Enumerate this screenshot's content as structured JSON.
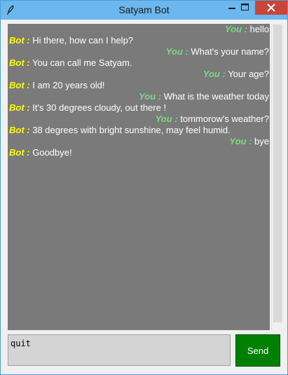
{
  "window": {
    "title": "Satyam Bot",
    "icon": "feather-icon",
    "controls": [
      "minimize-icon",
      "maximize-icon",
      "close-icon"
    ]
  },
  "chat": {
    "messages": [
      {
        "speaker": "You :",
        "text": " hello",
        "side": "you"
      },
      {
        "speaker": "Bot :",
        "text": " Hi there, how can I help?",
        "side": "bot"
      },
      {
        "speaker": "You :",
        "text": " What's your name?",
        "side": "you"
      },
      {
        "speaker": "Bot :",
        "text": " You can call me Satyam.",
        "side": "bot"
      },
      {
        "speaker": "You :",
        "text": " Your age?",
        "side": "you"
      },
      {
        "speaker": "Bot :",
        "text": " I am 20 years old!",
        "side": "bot"
      },
      {
        "speaker": "You :",
        "text": " What is the weather today",
        "side": "you"
      },
      {
        "speaker": "Bot :",
        "text": " It's 30 degrees cloudy, out there !",
        "side": "bot"
      },
      {
        "speaker": "You :",
        "text": " tommorow's weather?",
        "side": "you"
      },
      {
        "speaker": "Bot :",
        "text": " 38 degrees with bright sunshine, may feel humid.",
        "side": "bot"
      },
      {
        "speaker": "You :",
        "text": " bye",
        "side": "you"
      },
      {
        "speaker": "Bot :",
        "text": " Goodbye!",
        "side": "bot"
      }
    ]
  },
  "composer": {
    "input_value": "quit",
    "send_label": "Send"
  },
  "colors": {
    "titlebar": "#6cb7ee",
    "chat_background": "#7a7a7a",
    "bot_speaker": "#ffff00",
    "you_speaker": "#7cd882",
    "send_button": "#008000",
    "close_button": "#c7453b"
  }
}
